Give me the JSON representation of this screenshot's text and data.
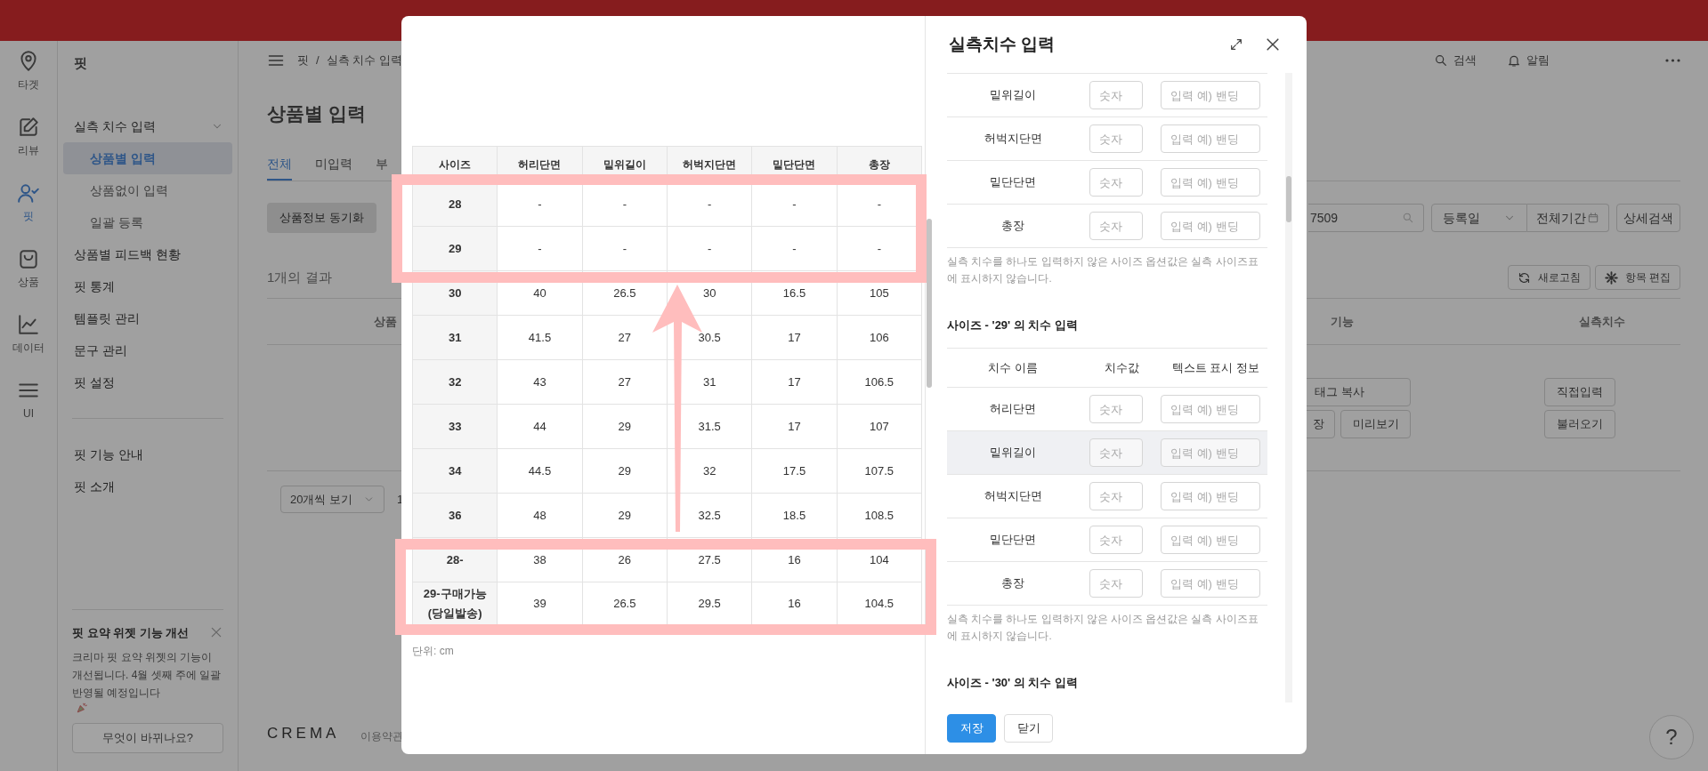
{
  "rail": [
    {
      "label": "타겟",
      "kind": "pin",
      "selected": false
    },
    {
      "label": "리뷰",
      "kind": "edit",
      "selected": false
    },
    {
      "label": "핏",
      "kind": "user",
      "selected": true
    },
    {
      "label": "상품",
      "kind": "bag",
      "selected": false
    },
    {
      "label": "데이터",
      "kind": "chart",
      "selected": false
    },
    {
      "label": "UI",
      "kind": "menu",
      "selected": false
    }
  ],
  "sidebar": {
    "title": "핏",
    "menu": [
      {
        "label": "실측 치수 입력",
        "selected": false,
        "expanded": true,
        "children": [
          {
            "label": "상품별 입력",
            "selected": true
          },
          {
            "label": "상품없이 입력",
            "selected": false
          },
          {
            "label": "일괄 등록",
            "selected": false
          }
        ]
      },
      {
        "label": "상품별 피드백 현황",
        "selected": false
      },
      {
        "label": "핏 통계",
        "selected": false
      },
      {
        "label": "템플릿 관리",
        "selected": false
      },
      {
        "label": "문구 관리",
        "selected": false
      },
      {
        "label": "핏 설정",
        "selected": false
      }
    ],
    "links": [
      "핏 기능 안내",
      "핏 소개"
    ],
    "notice": {
      "title": "핏 요약 위젯 기능 개선",
      "text": "크리마 핏 요약 위젯의 기능이 개선됩니다. 4월 셋째 주에 일괄 반영될 예정입니다",
      "button": "무엇이 바뀌나요?"
    }
  },
  "top_bar": {
    "breadcrumb": [
      "핏",
      "실측 치수 입력"
    ],
    "separator": "/",
    "search": "검색",
    "alerts": "알림"
  },
  "page_title": "상품별 입력",
  "tabs": [
    {
      "label": "전체",
      "selected": true
    },
    {
      "label": "미입력",
      "selected": false
    },
    {
      "label": "부",
      "selected": false
    }
  ],
  "sync_button": "상품정보 동기화",
  "search_value": "7509",
  "date_filter": {
    "field": "등록일",
    "period": "전체기간"
  },
  "detail_search": "상세검색",
  "result_count": "1개의 결과",
  "actions": [
    "새로고침",
    "항목 편집"
  ],
  "table": {
    "columns": [
      "상품",
      "기능",
      "실측치수"
    ],
    "row": {
      "feature_buttons": [
        [
          "태그 복사"
        ],
        [
          "장",
          "미리보기"
        ]
      ],
      "measure_buttons": [
        "직접입력",
        "불러오기"
      ]
    }
  },
  "page_size": "20개씩 보기",
  "page": "1",
  "footer": {
    "logo": "CREMA",
    "terms": "이용약관"
  },
  "help": "?",
  "modal": {
    "title": "실측치수 입력",
    "size_chart": {
      "columns": [
        "사이즈",
        "허리단면",
        "밑위길이",
        "허벅지단면",
        "밑단단면",
        "총장"
      ],
      "rows": [
        {
          "size": "28",
          "values": [
            "-",
            "-",
            "-",
            "-",
            "-"
          ]
        },
        {
          "size": "29",
          "values": [
            "-",
            "-",
            "-",
            "-",
            "-"
          ]
        },
        {
          "size": "30",
          "values": [
            "40",
            "26.5",
            "30",
            "16.5",
            "105"
          ]
        },
        {
          "size": "31",
          "values": [
            "41.5",
            "27",
            "30.5",
            "17",
            "106"
          ]
        },
        {
          "size": "32",
          "values": [
            "43",
            "27",
            "31",
            "17",
            "106.5"
          ]
        },
        {
          "size": "33",
          "values": [
            "44",
            "29",
            "31.5",
            "17",
            "107"
          ]
        },
        {
          "size": "34",
          "values": [
            "44.5",
            "29",
            "32",
            "17.5",
            "107.5"
          ]
        },
        {
          "size": "36",
          "values": [
            "48",
            "29",
            "32.5",
            "18.5",
            "108.5"
          ]
        },
        {
          "size": "28-",
          "values": [
            "38",
            "26",
            "27.5",
            "16",
            "104"
          ]
        },
        {
          "size": "29-구매가능(당일발송)",
          "values": [
            "39",
            "26.5",
            "29.5",
            "16",
            "104.5"
          ]
        }
      ],
      "unit": "단위: cm"
    },
    "sections": [
      {
        "rows": [
          {
            "name": "밑위길이",
            "value_placeholder": "숫자",
            "text_placeholder": "입력 예) 밴딩",
            "highlighted": false
          },
          {
            "name": "허벅지단면",
            "value_placeholder": "숫자",
            "text_placeholder": "입력 예) 밴딩",
            "highlighted": false
          },
          {
            "name": "밑단단면",
            "value_placeholder": "숫자",
            "text_placeholder": "입력 예) 밴딩",
            "highlighted": false
          },
          {
            "name": "총장",
            "value_placeholder": "숫자",
            "text_placeholder": "입력 예) 밴딩",
            "highlighted": false
          }
        ],
        "note": "실측 치수를 하나도 입력하지 않은 사이즈 옵션값은 실측 사이즈표에 표시하지 않습니다."
      },
      {
        "heading": "사이즈 - '29' 의 치수 입력",
        "columns": [
          "치수 이름",
          "치수값",
          "텍스트 표시 정보"
        ],
        "rows": [
          {
            "name": "허리단면",
            "value_placeholder": "숫자",
            "text_placeholder": "입력 예) 밴딩",
            "highlighted": false
          },
          {
            "name": "밑위길이",
            "value_placeholder": "숫자",
            "text_placeholder": "입력 예) 밴딩",
            "highlighted": true
          },
          {
            "name": "허벅지단면",
            "value_placeholder": "숫자",
            "text_placeholder": "입력 예) 밴딩",
            "highlighted": false
          },
          {
            "name": "밑단단면",
            "value_placeholder": "숫자",
            "text_placeholder": "입력 예) 밴딩",
            "highlighted": false
          },
          {
            "name": "총장",
            "value_placeholder": "숫자",
            "text_placeholder": "입력 예) 밴딩",
            "highlighted": false
          }
        ],
        "note": "실측 치수를 하나도 입력하지 않은 사이즈 옵션값은 실측 사이즈표에 표시하지 않습니다."
      },
      {
        "heading": "사이즈 - '30' 의 치수 입력"
      }
    ],
    "buttons": [
      {
        "label": "저장",
        "kind": "primary"
      },
      {
        "label": "닫기",
        "kind": "secondary"
      }
    ]
  }
}
